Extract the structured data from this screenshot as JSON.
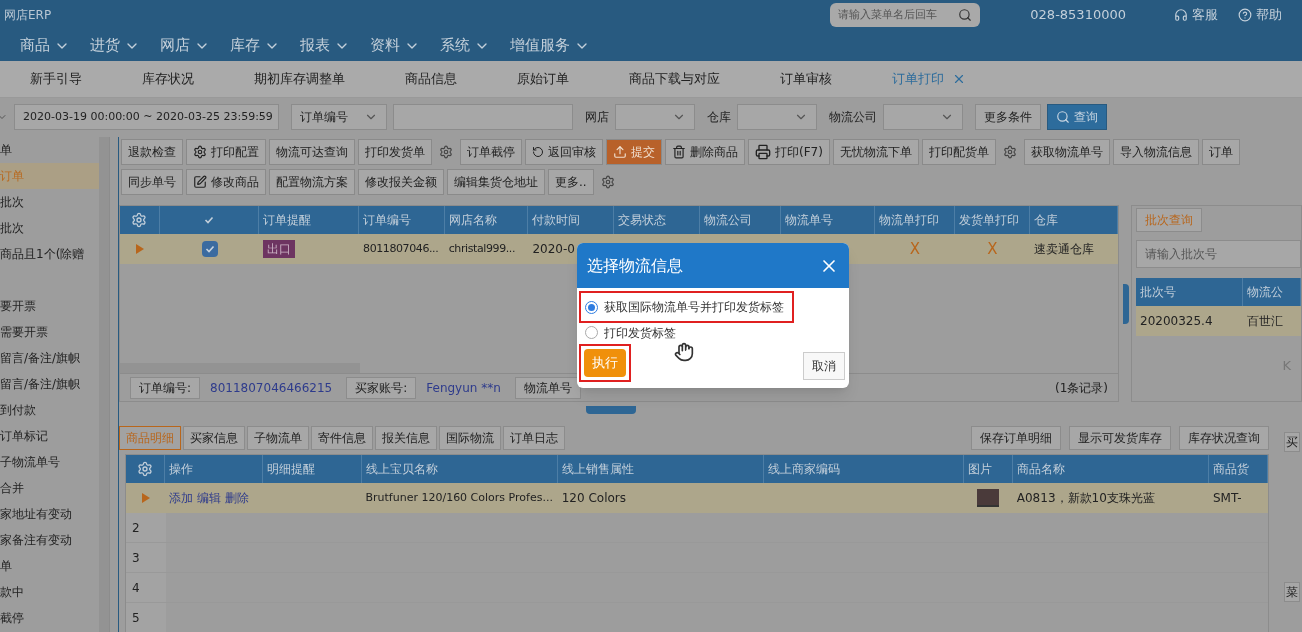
{
  "header": {
    "brand": "网店ERP",
    "search_placeholder": "请输入菜单名后回车",
    "phone": "028-85310000",
    "links": [
      {
        "kind": "headset",
        "label": "客服"
      },
      {
        "kind": "help",
        "label": "帮助"
      }
    ]
  },
  "menu": [
    "商品",
    "进货",
    "网店",
    "库存",
    "报表",
    "资料",
    "系统",
    "增值服务"
  ],
  "tabs": [
    {
      "label": "新手引导",
      "selected": false
    },
    {
      "label": "库存状况",
      "selected": false
    },
    {
      "label": "期初库存调整单",
      "selected": false
    },
    {
      "label": "商品信息",
      "selected": false
    },
    {
      "label": "原始订单",
      "selected": false
    },
    {
      "label": "商品下载与对应",
      "selected": false
    },
    {
      "label": "订单审核",
      "selected": false
    },
    {
      "label": "订单打印",
      "selected": true
    }
  ],
  "filter": {
    "date_range": "2020-03-19 00:00:00 ~ 2020-03-25 23:59:59",
    "field_select": "订单编号",
    "selects": [
      "网店",
      "仓库",
      "物流公司"
    ],
    "more": "更多条件",
    "search": "查询"
  },
  "sidebar": {
    "items": [
      {
        "label": "单",
        "selected": false
      },
      {
        "label": "订单",
        "selected": true
      },
      {
        "label": "批次",
        "selected": false
      },
      {
        "label": "批次",
        "selected": false
      },
      {
        "label": "商品且1个(除赠",
        "selected": false
      },
      {
        "label": "要开票",
        "selected": false
      },
      {
        "label": "需要开票",
        "selected": false
      },
      {
        "label": "留言/备注/旗帜",
        "selected": false
      },
      {
        "label": "留言/备注/旗帜",
        "selected": false
      },
      {
        "label": "到付款",
        "selected": false
      },
      {
        "label": "订单标记",
        "selected": false
      },
      {
        "label": "子物流单号",
        "selected": false
      },
      {
        "label": "合并",
        "selected": false
      },
      {
        "label": "家地址有变动",
        "selected": false
      },
      {
        "label": "家备注有变动",
        "selected": false
      },
      {
        "label": "单",
        "selected": false
      },
      {
        "label": "款中",
        "selected": false
      },
      {
        "label": "截停",
        "selected": false
      }
    ]
  },
  "toolbar_actions": [
    {
      "kind": "plain",
      "label": "退款检查"
    },
    {
      "kind": "gear",
      "label": "打印配置"
    },
    {
      "kind": "plain",
      "label": "物流可达查询"
    },
    {
      "kind": "plain",
      "label": "打印发货单"
    },
    {
      "kind": "gear-only"
    },
    {
      "kind": "plain",
      "label": "订单截停"
    },
    {
      "kind": "undo",
      "label": "返回审核"
    },
    {
      "kind": "primary",
      "label": "提交"
    },
    {
      "kind": "trash",
      "label": "删除商品"
    },
    {
      "kind": "printer",
      "label": "打印(F7)"
    },
    {
      "kind": "plain",
      "label": "无忧物流下单"
    },
    {
      "kind": "plain",
      "label": "打印配货单"
    },
    {
      "kind": "gear-only"
    },
    {
      "kind": "plain",
      "label": "获取物流单号"
    },
    {
      "kind": "plain",
      "label": "导入物流信息"
    },
    {
      "kind": "plain",
      "label": "订单"
    }
  ],
  "toolbar_more": [
    {
      "kind": "plain",
      "label": "同步单号"
    },
    {
      "kind": "edit",
      "label": "修改商品"
    },
    {
      "kind": "plain",
      "label": "配置物流方案"
    },
    {
      "kind": "plain",
      "label": "修改报关金额"
    },
    {
      "kind": "plain",
      "label": "编辑集货仓地址"
    },
    {
      "kind": "plain",
      "label": "更多.."
    },
    {
      "kind": "gear-only"
    }
  ],
  "orders": {
    "columns": [
      "订单提醒",
      "订单编号",
      "网店名称",
      "付款时间",
      "交易状态",
      "物流公司",
      "物流单号",
      "物流单打印",
      "发货单打印",
      "仓库"
    ],
    "rows": [
      {
        "selected": true,
        "checked": true,
        "tag": "出口",
        "order_no": "8011807046...",
        "shop": "christal999...",
        "pay_time": "2020-0",
        "logistics_print": "X",
        "invoice_print": "X",
        "warehouse": "速卖通仓库"
      }
    ],
    "footer": [
      {
        "label": "订单编号:",
        "value": "8011807046466215"
      },
      {
        "label": "买家账号:",
        "value": "Fengyun **n"
      },
      {
        "label": "物流单号"
      }
    ],
    "count": "(1条记录)"
  },
  "batch_panel": {
    "tab": "批次查询",
    "placeholder": "请输入批次号",
    "columns": [
      "批次号",
      "物流公"
    ],
    "rows": [
      [
        "20200325.4",
        "百世汇"
      ]
    ],
    "pager": "K"
  },
  "details": {
    "tabs": [
      {
        "label": "商品明细",
        "selected": true
      },
      {
        "label": "买家信息",
        "selected": false
      },
      {
        "label": "子物流单",
        "selected": false
      },
      {
        "label": "寄件信息",
        "selected": false
      },
      {
        "label": "报关信息",
        "selected": false
      },
      {
        "label": "国际物流",
        "selected": false
      },
      {
        "label": "订单日志",
        "selected": false
      }
    ],
    "actions": [
      "保存订单明细",
      "显示可发货库存",
      "库存状况查询"
    ],
    "columns": [
      "操作",
      "明细提醒",
      "线上宝贝名称",
      "线上销售属性",
      "线上商家编码",
      "图片",
      "商品名称",
      "商品货"
    ],
    "rows": [
      {
        "selected": true,
        "links": [
          "添加",
          "编辑",
          "删除"
        ],
        "item_name": "Brutfuner 120/160 Colors Profes...",
        "sale_attr": "120 Colors",
        "product_name": "A0813，新款10支珠光蓝",
        "code": "SMT-"
      }
    ],
    "empty_rows": [
      "2",
      "3",
      "4",
      "5"
    ],
    "side_labels": [
      "买",
      "菜"
    ]
  },
  "dialog": {
    "title": "选择物流信息",
    "options": [
      {
        "label": "获取国际物流单号并打印发货标签",
        "selected": true,
        "highlighted": true
      },
      {
        "label": "打印发货标签",
        "selected": false,
        "highlighted": false
      }
    ],
    "execute": {
      "label": "执行",
      "highlighted": true
    },
    "cancel": "取消"
  }
}
